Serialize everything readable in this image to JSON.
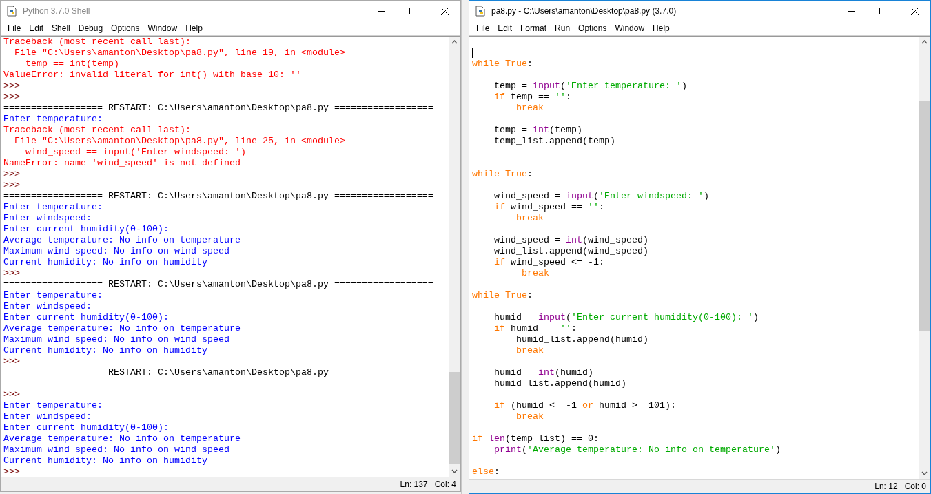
{
  "shell": {
    "title": "Python 3.7.0 Shell",
    "active": false,
    "menu": [
      "File",
      "Edit",
      "Shell",
      "Debug",
      "Options",
      "Window",
      "Help"
    ],
    "lines": [
      {
        "kind": "error",
        "text": "Traceback (most recent call last):"
      },
      {
        "kind": "error",
        "text": "  File \"C:\\Users\\amanton\\Desktop\\pa8.py\", line 19, in <module>"
      },
      {
        "kind": "error",
        "text": "    temp == int(temp)"
      },
      {
        "kind": "error",
        "text": "ValueError: invalid literal for int() with base 10: ''"
      },
      {
        "kind": "prompt",
        "text": ">>>"
      },
      {
        "kind": "prompt",
        "text": ">>>"
      },
      {
        "kind": "restart",
        "text": "================== RESTART: C:\\Users\\amanton\\Desktop\\pa8.py =================="
      },
      {
        "kind": "output",
        "text": "Enter temperature:"
      },
      {
        "kind": "error",
        "text": "Traceback (most recent call last):"
      },
      {
        "kind": "error",
        "text": "  File \"C:\\Users\\amanton\\Desktop\\pa8.py\", line 25, in <module>"
      },
      {
        "kind": "error",
        "text": "    wind_speed == input('Enter windspeed: ')"
      },
      {
        "kind": "error",
        "text": "NameError: name 'wind_speed' is not defined"
      },
      {
        "kind": "prompt",
        "text": ">>>"
      },
      {
        "kind": "prompt",
        "text": ">>>"
      },
      {
        "kind": "restart",
        "text": "================== RESTART: C:\\Users\\amanton\\Desktop\\pa8.py =================="
      },
      {
        "kind": "output",
        "text": "Enter temperature:"
      },
      {
        "kind": "output",
        "text": "Enter windspeed:"
      },
      {
        "kind": "output",
        "text": "Enter current humidity(0-100):"
      },
      {
        "kind": "output",
        "text": "Average temperature: No info on temperature"
      },
      {
        "kind": "output",
        "text": "Maximum wind speed: No info on wind speed"
      },
      {
        "kind": "output",
        "text": "Current humidity: No info on humidity"
      },
      {
        "kind": "prompt",
        "text": ">>>"
      },
      {
        "kind": "restart",
        "text": "================== RESTART: C:\\Users\\amanton\\Desktop\\pa8.py =================="
      },
      {
        "kind": "output",
        "text": "Enter temperature:"
      },
      {
        "kind": "output",
        "text": "Enter windspeed:"
      },
      {
        "kind": "output",
        "text": "Enter current humidity(0-100):"
      },
      {
        "kind": "output",
        "text": "Average temperature: No info on temperature"
      },
      {
        "kind": "output",
        "text": "Maximum wind speed: No info on wind speed"
      },
      {
        "kind": "output",
        "text": "Current humidity: No info on humidity"
      },
      {
        "kind": "prompt",
        "text": ">>>"
      },
      {
        "kind": "restart",
        "text": "================== RESTART: C:\\Users\\amanton\\Desktop\\pa8.py =================="
      },
      {
        "kind": "blank"
      },
      {
        "kind": "prompt",
        "text": ">>>"
      },
      {
        "kind": "output",
        "text": "Enter temperature:"
      },
      {
        "kind": "output",
        "text": "Enter windspeed:"
      },
      {
        "kind": "output",
        "text": "Enter current humidity(0-100):"
      },
      {
        "kind": "output",
        "text": "Average temperature: No info on temperature"
      },
      {
        "kind": "output",
        "text": "Maximum wind speed: No info on wind speed"
      },
      {
        "kind": "output",
        "text": "Current humidity: No info on humidity"
      },
      {
        "kind": "prompt",
        "text": ">>>"
      }
    ],
    "status": {
      "line": "Ln: 137",
      "col": "Col: 4"
    }
  },
  "editor": {
    "title": "pa8.py - C:\\Users\\amanton\\Desktop\\pa8.py (3.7.0)",
    "active": true,
    "menu": [
      "File",
      "Edit",
      "Format",
      "Run",
      "Options",
      "Window",
      "Help"
    ],
    "lines": [
      {
        "cursor": false
      },
      {
        "cursor": true
      },
      {
        "cursor": false,
        "tokens": [
          {
            "kind": "keyword",
            "text": "while True"
          },
          {
            "kind": "plain",
            "text": ":"
          }
        ]
      },
      {
        "cursor": false
      },
      {
        "cursor": false,
        "tokens": [
          {
            "kind": "plain",
            "text": "    temp = "
          },
          {
            "kind": "builtin",
            "text": "input"
          },
          {
            "kind": "plain",
            "text": "("
          },
          {
            "kind": "string",
            "text": "'Enter temperature: '"
          },
          {
            "kind": "plain",
            "text": ")"
          }
        ]
      },
      {
        "cursor": false,
        "tokens": [
          {
            "kind": "keyword",
            "text": "    if"
          },
          {
            "kind": "plain",
            "text": " temp == "
          },
          {
            "kind": "string",
            "text": "''"
          },
          {
            "kind": "plain",
            "text": ":"
          }
        ]
      },
      {
        "cursor": false,
        "tokens": [
          {
            "kind": "keyword",
            "text": "        break"
          }
        ]
      },
      {
        "cursor": false
      },
      {
        "cursor": false,
        "tokens": [
          {
            "kind": "plain",
            "text": "    temp = "
          },
          {
            "kind": "builtin",
            "text": "int"
          },
          {
            "kind": "plain",
            "text": "(temp)"
          }
        ]
      },
      {
        "cursor": false,
        "tokens": [
          {
            "kind": "plain",
            "text": "    temp_list.append(temp)"
          }
        ]
      },
      {
        "cursor": false
      },
      {
        "cursor": false
      },
      {
        "cursor": false,
        "tokens": [
          {
            "kind": "keyword",
            "text": "while True"
          },
          {
            "kind": "plain",
            "text": ":"
          }
        ]
      },
      {
        "cursor": false
      },
      {
        "cursor": false,
        "tokens": [
          {
            "kind": "plain",
            "text": "    wind_speed = "
          },
          {
            "kind": "builtin",
            "text": "input"
          },
          {
            "kind": "plain",
            "text": "("
          },
          {
            "kind": "string",
            "text": "'Enter windspeed: '"
          },
          {
            "kind": "plain",
            "text": ")"
          }
        ]
      },
      {
        "cursor": false,
        "tokens": [
          {
            "kind": "keyword",
            "text": "    if"
          },
          {
            "kind": "plain",
            "text": " wind_speed == "
          },
          {
            "kind": "string",
            "text": "''"
          },
          {
            "kind": "plain",
            "text": ":"
          }
        ]
      },
      {
        "cursor": false,
        "tokens": [
          {
            "kind": "keyword",
            "text": "        break"
          }
        ]
      },
      {
        "cursor": false
      },
      {
        "cursor": false,
        "tokens": [
          {
            "kind": "plain",
            "text": "    wind_speed = "
          },
          {
            "kind": "builtin",
            "text": "int"
          },
          {
            "kind": "plain",
            "text": "(wind_speed)"
          }
        ]
      },
      {
        "cursor": false,
        "tokens": [
          {
            "kind": "plain",
            "text": "    wind_list.append(wind_speed)"
          }
        ]
      },
      {
        "cursor": false,
        "tokens": [
          {
            "kind": "keyword",
            "text": "    if"
          },
          {
            "kind": "plain",
            "text": " wind_speed <= -1:"
          }
        ]
      },
      {
        "cursor": false,
        "tokens": [
          {
            "kind": "keyword",
            "text": "         break"
          }
        ]
      },
      {
        "cursor": false
      },
      {
        "cursor": false,
        "tokens": [
          {
            "kind": "keyword",
            "text": "while True"
          },
          {
            "kind": "plain",
            "text": ":"
          }
        ]
      },
      {
        "cursor": false
      },
      {
        "cursor": false,
        "tokens": [
          {
            "kind": "plain",
            "text": "    humid = "
          },
          {
            "kind": "builtin",
            "text": "input"
          },
          {
            "kind": "plain",
            "text": "("
          },
          {
            "kind": "string",
            "text": "'Enter current humidity(0-100): '"
          },
          {
            "kind": "plain",
            "text": ")"
          }
        ]
      },
      {
        "cursor": false,
        "tokens": [
          {
            "kind": "keyword",
            "text": "    if"
          },
          {
            "kind": "plain",
            "text": " humid == "
          },
          {
            "kind": "string",
            "text": "''"
          },
          {
            "kind": "plain",
            "text": ":"
          }
        ]
      },
      {
        "cursor": false,
        "tokens": [
          {
            "kind": "plain",
            "text": "        humid_list.append(humid)"
          }
        ]
      },
      {
        "cursor": false,
        "tokens": [
          {
            "kind": "keyword",
            "text": "        break"
          }
        ]
      },
      {
        "cursor": false
      },
      {
        "cursor": false,
        "tokens": [
          {
            "kind": "plain",
            "text": "    humid = "
          },
          {
            "kind": "builtin",
            "text": "int"
          },
          {
            "kind": "plain",
            "text": "(humid)"
          }
        ]
      },
      {
        "cursor": false,
        "tokens": [
          {
            "kind": "plain",
            "text": "    humid_list.append(humid)"
          }
        ]
      },
      {
        "cursor": false
      },
      {
        "cursor": false,
        "tokens": [
          {
            "kind": "keyword",
            "text": "    if"
          },
          {
            "kind": "plain",
            "text": " (humid <= -1 "
          },
          {
            "kind": "keyword",
            "text": "or"
          },
          {
            "kind": "plain",
            "text": " humid >= 101):"
          }
        ]
      },
      {
        "cursor": false,
        "tokens": [
          {
            "kind": "keyword",
            "text": "        break"
          }
        ]
      },
      {
        "cursor": false
      },
      {
        "cursor": false,
        "tokens": [
          {
            "kind": "keyword",
            "text": "if"
          },
          {
            "kind": "builtin",
            "text": " len"
          },
          {
            "kind": "plain",
            "text": "(temp_list) == 0:"
          }
        ]
      },
      {
        "cursor": false,
        "tokens": [
          {
            "kind": "builtin",
            "text": "    print"
          },
          {
            "kind": "plain",
            "text": "("
          },
          {
            "kind": "string",
            "text": "'Average temperature: No info on temperature'"
          },
          {
            "kind": "plain",
            "text": ")"
          }
        ]
      },
      {
        "cursor": false
      },
      {
        "cursor": false,
        "tokens": [
          {
            "kind": "keyword",
            "text": "else"
          },
          {
            "kind": "plain",
            "text": ":"
          }
        ]
      }
    ],
    "status": {
      "line": "Ln: 12",
      "col": "Col: 0"
    }
  }
}
